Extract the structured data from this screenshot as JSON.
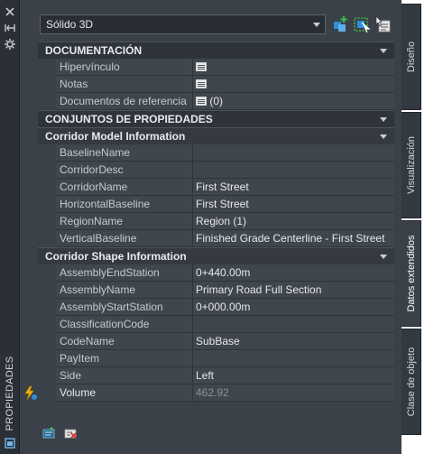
{
  "palette_title": "PROPIEDADES",
  "object_type": "Sólido 3D",
  "tabs": [
    "Diseño",
    "Visualización",
    "Datos extendidos",
    "Clase de objeto"
  ],
  "sections": {
    "documentacion": {
      "header": "DOCUMENTACIÓN",
      "rows": [
        {
          "name": "Hipervínculo",
          "value": ""
        },
        {
          "name": "Notas",
          "value": ""
        },
        {
          "name": "Documentos de referencia",
          "value": "(0)"
        }
      ]
    },
    "conjuntos": {
      "header": "CONJUNTOS DE PROPIEDADES"
    },
    "corridor_model": {
      "header": "Corridor Model Information",
      "rows": [
        {
          "name": "BaselineName",
          "value": ""
        },
        {
          "name": "CorridorDesc",
          "value": ""
        },
        {
          "name": "CorridorName",
          "value": "First Street"
        },
        {
          "name": "HorizontalBaseline",
          "value": "First Street"
        },
        {
          "name": "RegionName",
          "value": "Region (1)"
        },
        {
          "name": "VerticalBaseline",
          "value": "Finished Grade Centerline - First Street"
        }
      ]
    },
    "corridor_shape": {
      "header": "Corridor Shape Information",
      "rows": [
        {
          "name": "AssemblyEndStation",
          "value": "0+440.00m"
        },
        {
          "name": "AssemblyName",
          "value": "Primary Road Full Section"
        },
        {
          "name": "AssemblyStartStation",
          "value": "0+000.00m"
        },
        {
          "name": "ClassificationCode",
          "value": ""
        },
        {
          "name": "CodeName",
          "value": "SubBase"
        },
        {
          "name": "PayItem",
          "value": ""
        },
        {
          "name": "Side",
          "value": "Left"
        },
        {
          "name": "Volume",
          "value": "462.92"
        }
      ]
    }
  },
  "icons": {
    "titlebar": [
      "close-icon",
      "auto-hide-icon",
      "settings-icon"
    ],
    "toolbar": [
      "add-selection-icon",
      "quick-select-icon",
      "select-objects-icon"
    ],
    "bottom": [
      "add-property-set-icon",
      "remove-property-set-icon"
    ],
    "volume_row": "calculated-field-icon",
    "doc_rows": "edit-list-icon"
  },
  "colors": {
    "panel": "#3b4149",
    "header": "#2f343b",
    "accent_blue": "#2f8fd6",
    "accent_green": "#3cb54a"
  }
}
